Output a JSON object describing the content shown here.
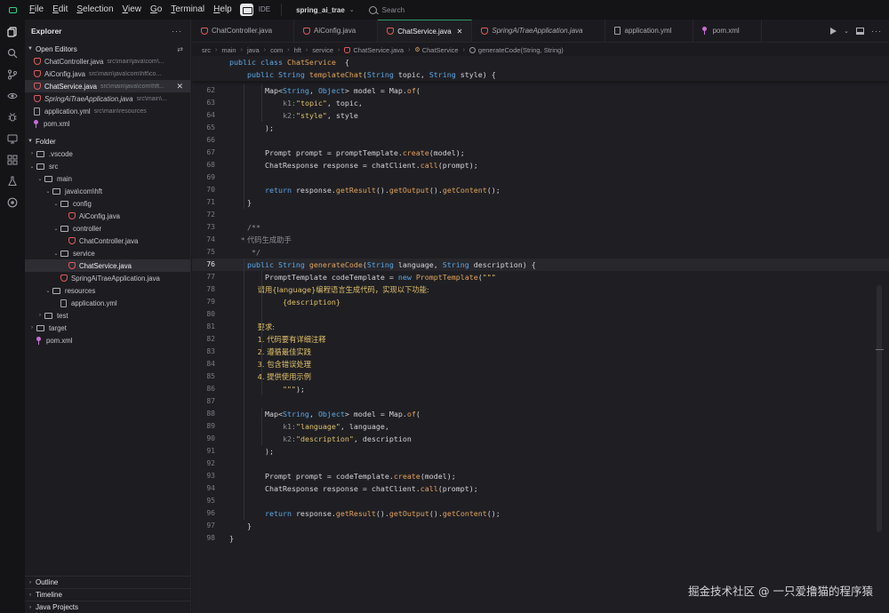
{
  "menu": [
    {
      "key": "F",
      "rest": "ile"
    },
    {
      "key": "E",
      "rest": "dit"
    },
    {
      "key": "S",
      "rest": "election"
    },
    {
      "key": "V",
      "rest": "iew"
    },
    {
      "key": "G",
      "rest": "o"
    },
    {
      "key": "T",
      "rest": "erminal"
    },
    {
      "key": "H",
      "rest": "elp"
    }
  ],
  "ide_label": "IDE",
  "project": "spring_ai_trae",
  "search_placeholder": "Search",
  "explorer": {
    "title": "Explorer",
    "open_editors_label": "Open Editors",
    "open_editors": [
      {
        "name": "ChatController.java",
        "path": "src\\main\\java\\com\\...",
        "icon": "java",
        "italic": false,
        "active": false
      },
      {
        "name": "AiConfig.java",
        "path": "src\\main\\java\\com\\hft\\co...",
        "icon": "java",
        "italic": false,
        "active": false
      },
      {
        "name": "ChatService.java",
        "path": "src\\main\\java\\com\\hft...",
        "icon": "java",
        "italic": false,
        "active": true
      },
      {
        "name": "SpringAiTraeApplication.java",
        "path": "src\\main\\...",
        "icon": "java",
        "italic": true,
        "active": false
      },
      {
        "name": "application.yml",
        "path": "src\\main\\resources",
        "icon": "file",
        "italic": false,
        "active": false
      },
      {
        "name": "pom.xml",
        "path": "",
        "icon": "xml",
        "italic": false,
        "active": false
      }
    ],
    "folder_label": "Folder",
    "tree": [
      {
        "name": ".vscode",
        "depth": 0,
        "type": "folder",
        "open": false
      },
      {
        "name": "src",
        "depth": 0,
        "type": "folder",
        "open": true
      },
      {
        "name": "main",
        "depth": 1,
        "type": "folder",
        "open": true
      },
      {
        "name": "java\\com\\hft",
        "depth": 2,
        "type": "folder",
        "open": true
      },
      {
        "name": "config",
        "depth": 3,
        "type": "folder",
        "open": true
      },
      {
        "name": "AiConfig.java",
        "depth": 4,
        "type": "java"
      },
      {
        "name": "controller",
        "depth": 3,
        "type": "folder",
        "open": true
      },
      {
        "name": "ChatController.java",
        "depth": 4,
        "type": "java"
      },
      {
        "name": "service",
        "depth": 3,
        "type": "folder",
        "open": true
      },
      {
        "name": "ChatService.java",
        "depth": 4,
        "type": "java",
        "selected": true
      },
      {
        "name": "SpringAiTraeApplication.java",
        "depth": 3,
        "type": "java"
      },
      {
        "name": "resources",
        "depth": 2,
        "type": "folder",
        "open": true
      },
      {
        "name": "application.yml",
        "depth": 3,
        "type": "file"
      },
      {
        "name": "test",
        "depth": 1,
        "type": "folder",
        "open": false
      },
      {
        "name": "target",
        "depth": 0,
        "type": "folder",
        "open": false
      },
      {
        "name": "pom.xml",
        "depth": 0,
        "type": "xml"
      }
    ],
    "bottom_sections": [
      "Outline",
      "Timeline",
      "Java Projects"
    ]
  },
  "tabs": [
    {
      "label": "ChatController.java",
      "icon": "java",
      "active": false,
      "italic": false
    },
    {
      "label": "AiConfig.java",
      "icon": "java",
      "active": false,
      "italic": false
    },
    {
      "label": "ChatService.java",
      "icon": "java",
      "active": true,
      "italic": false
    },
    {
      "label": "SpringAiTraeApplication.java",
      "icon": "java",
      "active": false,
      "italic": true
    },
    {
      "label": "application.yml",
      "icon": "file",
      "active": false,
      "italic": false
    },
    {
      "label": "pom.xml",
      "icon": "xml",
      "active": false,
      "italic": false
    }
  ],
  "breadcrumb": [
    "src",
    "main",
    "java",
    "com",
    "hft",
    "service",
    "ChatService.java",
    "ChatService",
    "generateCode(String, String)"
  ],
  "editor": {
    "sticky": [
      [
        [
          "kw",
          "public "
        ],
        [
          "kw",
          "class "
        ],
        [
          "fn",
          "ChatService"
        ],
        [
          "",
          "  {"
        ]
      ],
      [
        [
          "",
          "    "
        ],
        [
          "kw",
          "public "
        ],
        [
          "ty",
          "String "
        ],
        [
          "fn",
          "templateChat"
        ],
        [
          "",
          "("
        ],
        [
          "ty",
          "String "
        ],
        [
          "",
          "topic, "
        ],
        [
          "ty",
          "String "
        ],
        [
          "",
          "style) {"
        ]
      ]
    ],
    "current_line": 76,
    "lines": [
      {
        "n": 62,
        "t": [
          [
            "",
            "        Map<"
          ],
          [
            "ty",
            "String"
          ],
          [
            ", ",
            ""
          ],
          [
            "ty",
            "Object"
          ],
          [
            "",
            "> model = Map."
          ],
          [
            "fn",
            "of"
          ],
          [
            "",
            "("
          ]
        ]
      },
      {
        "n": 63,
        "t": [
          [
            "",
            "            "
          ],
          [
            "hint",
            "k1:"
          ],
          [
            "str",
            "\"topic\""
          ],
          [
            "",
            ", topic,"
          ]
        ]
      },
      {
        "n": 64,
        "t": [
          [
            "",
            "            "
          ],
          [
            "hint",
            "k2:"
          ],
          [
            "str",
            "\"style\""
          ],
          [
            "",
            ", style"
          ]
        ]
      },
      {
        "n": 65,
        "t": [
          [
            "",
            "        );"
          ]
        ]
      },
      {
        "n": 66,
        "t": []
      },
      {
        "n": 67,
        "t": [
          [
            "",
            "        Prompt prompt = promptTemplate."
          ],
          [
            "fn",
            "create"
          ],
          [
            "",
            "(model);"
          ]
        ]
      },
      {
        "n": 68,
        "t": [
          [
            "",
            "        ChatResponse response = chatClient."
          ],
          [
            "fn",
            "call"
          ],
          [
            "",
            "(prompt);"
          ]
        ]
      },
      {
        "n": 69,
        "t": []
      },
      {
        "n": 70,
        "t": [
          [
            "",
            "        "
          ],
          [
            "kw",
            "return "
          ],
          [
            "",
            "response."
          ],
          [
            "fn",
            "getResult"
          ],
          [
            "",
            "()."
          ],
          [
            "fn",
            "getOutput"
          ],
          [
            "",
            "()."
          ],
          [
            "fn",
            "getContent"
          ],
          [
            "",
            "();"
          ]
        ]
      },
      {
        "n": 71,
        "t": [
          [
            "",
            "    }"
          ]
        ]
      },
      {
        "n": 72,
        "t": []
      },
      {
        "n": 73,
        "t": [
          [
            "cm",
            "    /**"
          ]
        ]
      },
      {
        "n": 74,
        "t": [
          [
            "cm",
            "     * 代码生成助手"
          ]
        ]
      },
      {
        "n": 75,
        "t": [
          [
            "cm",
            "     */"
          ]
        ]
      },
      {
        "n": 76,
        "t": [
          [
            "",
            "    "
          ],
          [
            "kw",
            "public "
          ],
          [
            "ty",
            "String "
          ],
          [
            "fn",
            "generateCode"
          ],
          [
            "",
            "("
          ],
          [
            "ty",
            "String "
          ],
          [
            "",
            "language, "
          ],
          [
            "ty",
            "String "
          ],
          [
            "",
            "description) {"
          ]
        ]
      },
      {
        "n": 77,
        "t": [
          [
            "",
            "        PromptTemplate codeTemplate = "
          ],
          [
            "kw",
            "new "
          ],
          [
            "fn",
            "PromptTemplate"
          ],
          [
            "",
            "("
          ],
          [
            "str",
            "\"\"\""
          ]
        ]
      },
      {
        "n": 78,
        "t": [
          [
            "str",
            "            请用{language}编程语言生成代码，实现以下功能:"
          ]
        ]
      },
      {
        "n": 79,
        "t": [
          [
            "str",
            "            {description}"
          ]
        ]
      },
      {
        "n": 80,
        "t": []
      },
      {
        "n": 81,
        "t": [
          [
            "str",
            "            要求:"
          ]
        ]
      },
      {
        "n": 82,
        "t": [
          [
            "str",
            "            1. 代码要有详细注释"
          ]
        ]
      },
      {
        "n": 83,
        "t": [
          [
            "str",
            "            2. 遵循最佳实践"
          ]
        ]
      },
      {
        "n": 84,
        "t": [
          [
            "str",
            "            3. 包含错误处理"
          ]
        ]
      },
      {
        "n": 85,
        "t": [
          [
            "str",
            "            4. 提供使用示例"
          ]
        ]
      },
      {
        "n": 86,
        "t": [
          [
            "str",
            "            \"\"\""
          ],
          [
            "",
            ");"
          ]
        ]
      },
      {
        "n": 87,
        "t": []
      },
      {
        "n": 88,
        "t": [
          [
            "",
            "        Map<"
          ],
          [
            "ty",
            "String"
          ],
          [
            "",
            ", "
          ],
          [
            "ty",
            "Object"
          ],
          [
            "",
            "> model = Map."
          ],
          [
            "fn",
            "of"
          ],
          [
            "",
            "("
          ]
        ]
      },
      {
        "n": 89,
        "t": [
          [
            "",
            "            "
          ],
          [
            "hint",
            "k1:"
          ],
          [
            "str",
            "\"language\""
          ],
          [
            "",
            ", language,"
          ]
        ]
      },
      {
        "n": 90,
        "t": [
          [
            "",
            "            "
          ],
          [
            "hint",
            "k2:"
          ],
          [
            "str",
            "\"description\""
          ],
          [
            "",
            ", description"
          ]
        ]
      },
      {
        "n": 91,
        "t": [
          [
            "",
            "        );"
          ]
        ]
      },
      {
        "n": 92,
        "t": []
      },
      {
        "n": 93,
        "t": [
          [
            "",
            "        Prompt prompt = codeTemplate."
          ],
          [
            "fn",
            "create"
          ],
          [
            "",
            "(model);"
          ]
        ]
      },
      {
        "n": 94,
        "t": [
          [
            "",
            "        ChatResponse response = chatClient."
          ],
          [
            "fn",
            "call"
          ],
          [
            "",
            "(prompt);"
          ]
        ]
      },
      {
        "n": 95,
        "t": []
      },
      {
        "n": 96,
        "t": [
          [
            "",
            "        "
          ],
          [
            "kw",
            "return "
          ],
          [
            "",
            "response."
          ],
          [
            "fn",
            "getResult"
          ],
          [
            "",
            "()."
          ],
          [
            "fn",
            "getOutput"
          ],
          [
            "",
            "()."
          ],
          [
            "fn",
            "getContent"
          ],
          [
            "",
            "();"
          ]
        ]
      },
      {
        "n": 97,
        "t": [
          [
            "",
            "    }"
          ]
        ]
      },
      {
        "n": 98,
        "t": [
          [
            "",
            "}"
          ]
        ]
      }
    ]
  },
  "watermark": "掘金技术社区 @ 一只爱撸猫的程序猿",
  "colors": {
    "accent": "#2f9b6b",
    "keyword": "#5aa9e6",
    "string": "#e0c068",
    "function": "#e3a35b",
    "java_icon": "#e05a5a",
    "xml_icon": "#c86dd7"
  }
}
